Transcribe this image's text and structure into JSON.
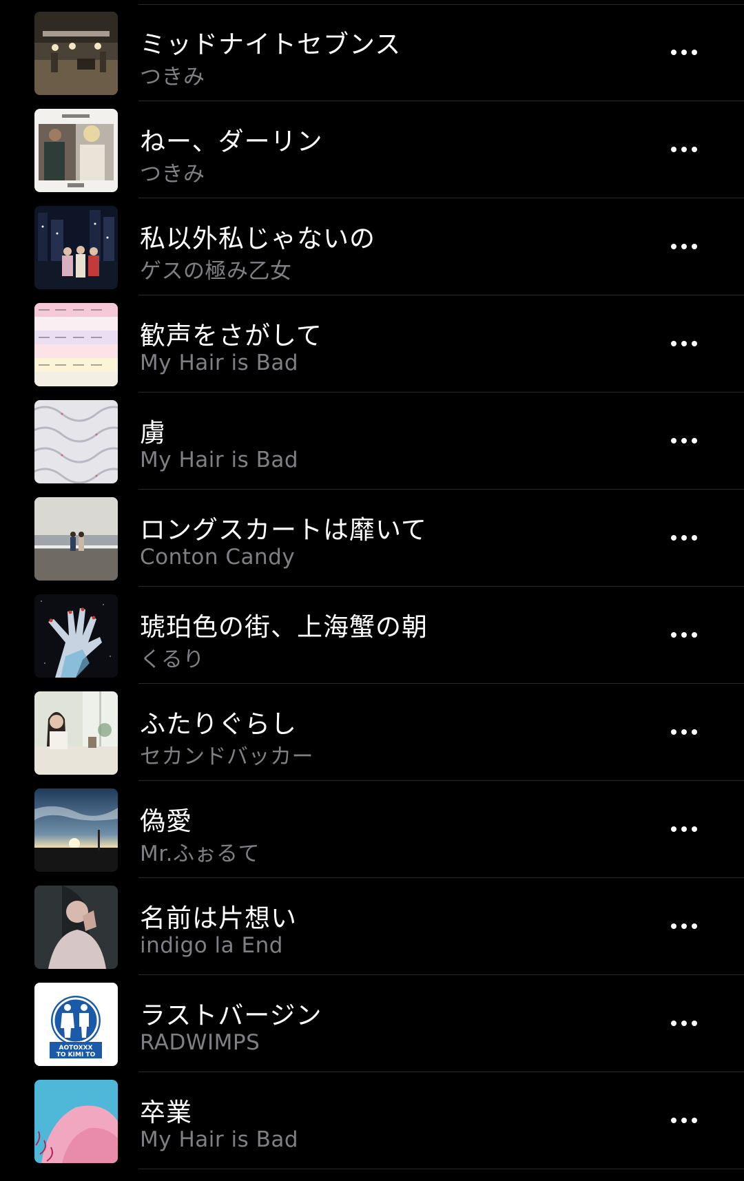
{
  "songs": [
    {
      "title": "ミッドナイトセブンス",
      "artist": "つきみ",
      "art": "band-stage-art",
      "more_icon": "more-icon"
    },
    {
      "title": "ねー、ダーリン",
      "artist": "つきみ",
      "art": "couple-photo-art",
      "more_icon": "more-icon"
    },
    {
      "title": "私以外私じゃないの",
      "artist": "ゲスの極み乙女",
      "art": "night-city-art",
      "more_icon": "more-icon"
    },
    {
      "title": "歓声をさがして",
      "artist": "My Hair is Bad",
      "art": "pastel-stripes-art",
      "more_icon": "more-icon"
    },
    {
      "title": "虜",
      "artist": "My Hair is Bad",
      "art": "quilted-white-art",
      "more_icon": "more-icon"
    },
    {
      "title": "ロングスカートは靡いて",
      "artist": "Conton Candy",
      "art": "seaside-couple-art",
      "more_icon": "more-icon"
    },
    {
      "title": "琥珀色の街、上海蟹の朝",
      "artist": "くるり",
      "art": "glitter-hand-art",
      "more_icon": "more-icon"
    },
    {
      "title": "ふたりぐらし",
      "artist": "セカンドバッカー",
      "art": "window-portrait-art",
      "more_icon": "more-icon"
    },
    {
      "title": "偽愛",
      "artist": "Mr.ふぉるて",
      "art": "sunset-sky-art",
      "more_icon": "more-icon"
    },
    {
      "title": "名前は片想い",
      "artist": "indigo la End",
      "art": "soft-portrait-art",
      "more_icon": "more-icon"
    },
    {
      "title": "ラストバージン",
      "artist": "RADWIMPS",
      "art": "restroom-sign-art",
      "more_icon": "more-icon",
      "art_text": [
        "AOTOXXX",
        "TO KIMI TO"
      ]
    },
    {
      "title": "卒業",
      "artist": "My Hair is Bad",
      "art": "pink-shape-art",
      "more_icon": "more-icon"
    }
  ],
  "colors": {
    "background": "#000000",
    "title": "#ffffff",
    "artist": "#7f7f85",
    "divider": "#2a2a2d"
  }
}
